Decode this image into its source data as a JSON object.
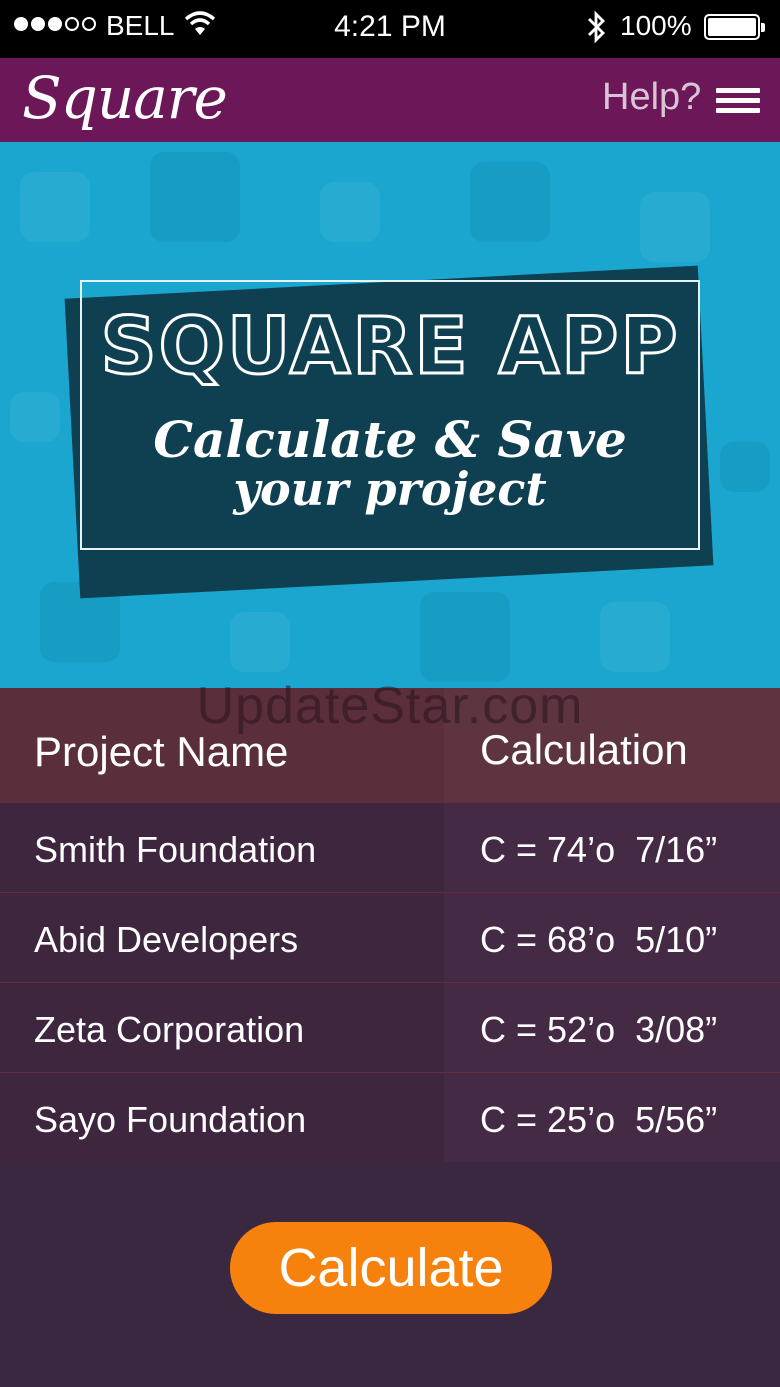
{
  "status_bar": {
    "carrier": "BELL",
    "time": "4:21 PM",
    "battery": "100%"
  },
  "nav": {
    "brand": "Square",
    "help_label": "Help?"
  },
  "hero": {
    "title": "SQUARE APP",
    "subtitle_line1": "Calculate & Save",
    "subtitle_line2": "your project"
  },
  "watermark": "UpdateStar.com",
  "table": {
    "headers": {
      "name": "Project Name",
      "calculation": "Calculation"
    },
    "rows": [
      {
        "name": "Smith Foundation",
        "calculation": "C = 74’o  7/16”"
      },
      {
        "name": "Abid Developers",
        "calculation": "C = 68’o  5/10”"
      },
      {
        "name": "Zeta Corporation",
        "calculation": "C = 52’o  3/08”"
      },
      {
        "name": "Sayo Foundation",
        "calculation": "C = 25’o  5/56”"
      }
    ]
  },
  "actions": {
    "calculate_label": "Calculate"
  },
  "colors": {
    "nav_bg": "#6c1758",
    "hero_bg": "#1aa6cf",
    "banner_bg": "#0f4052",
    "button_bg": "#f6820d"
  }
}
